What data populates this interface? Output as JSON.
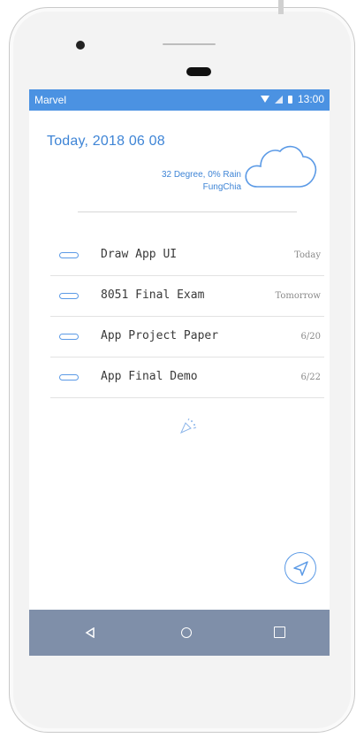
{
  "status_bar": {
    "app_name": "Marvel",
    "time": "13:00",
    "icons": [
      "wifi-icon",
      "signal-icon",
      "battery-icon"
    ]
  },
  "header": {
    "date": "Today, 2018 06 08",
    "weather_line1": "32 Degree,  0% Rain",
    "weather_line2": "FungChia",
    "weather_icon": "cloud-icon"
  },
  "todos": [
    {
      "task": "Draw App UI",
      "due": "Today"
    },
    {
      "task": "8051 Final Exam",
      "due": "Tomorrow"
    },
    {
      "task": "App Project Paper",
      "due": "6/20"
    },
    {
      "task": "App Final Demo",
      "due": "6/22"
    }
  ],
  "decor_icon": "party-popper-icon",
  "fab_icon": "send-icon",
  "nav": {
    "back_icon": "back-triangle-icon",
    "home_icon": "home-circle-icon",
    "recent_icon": "recent-square-icon"
  },
  "colors": {
    "accent": "#4b92e2",
    "text_blue": "#3f85d6",
    "navbar": "#7f8fa9"
  }
}
